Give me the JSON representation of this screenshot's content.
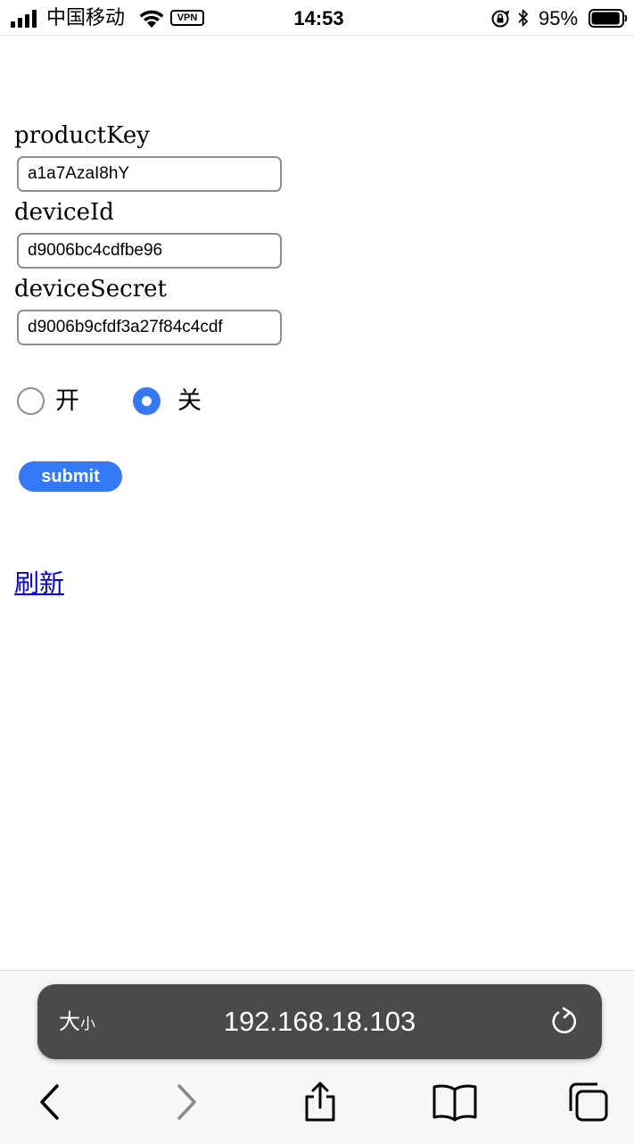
{
  "status_bar": {
    "carrier": "中国移动",
    "vpn": "VPN",
    "time": "14:53",
    "battery_percent": "95%",
    "battery_level": 0.95
  },
  "form": {
    "product_key": {
      "label": "productKey",
      "value": "a1a7AzaI8hY"
    },
    "device_id": {
      "label": "deviceId",
      "value": "d9006bc4cdfbe96"
    },
    "device_secret": {
      "label": "deviceSecret",
      "value": "d9006b9cfdf3a27f84c4cdf"
    },
    "radio_on_label": "开",
    "radio_off_label": "关",
    "selected": "关",
    "submit_label": "submit",
    "refresh_label": "刷新"
  },
  "browser": {
    "text_size_label": "大",
    "text_size_small": "小",
    "url": "192.168.18.103"
  },
  "colors": {
    "accent": "#3478f6",
    "link": "#0000ee",
    "url_bar_bg": "#4a4a4a"
  }
}
